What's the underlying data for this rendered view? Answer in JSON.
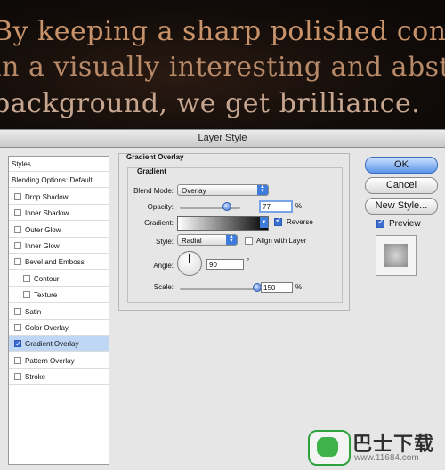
{
  "hero": {
    "line1": "By keeping a sharp polished content",
    "line2": "in a visually interesting and abstract",
    "line3": "background, we get brilliance."
  },
  "dialog": {
    "title": "Layer Style",
    "styles_panel": {
      "items": [
        {
          "label": "Styles",
          "checkbox": false,
          "checked": false,
          "selected": false,
          "indent": 0
        },
        {
          "label": "Blending Options: Default",
          "checkbox": false,
          "checked": false,
          "selected": false,
          "indent": 0
        },
        {
          "label": "Drop Shadow",
          "checkbox": true,
          "checked": false,
          "selected": false,
          "indent": 0
        },
        {
          "label": "Inner Shadow",
          "checkbox": true,
          "checked": false,
          "selected": false,
          "indent": 0
        },
        {
          "label": "Outer Glow",
          "checkbox": true,
          "checked": false,
          "selected": false,
          "indent": 0
        },
        {
          "label": "Inner Glow",
          "checkbox": true,
          "checked": false,
          "selected": false,
          "indent": 0
        },
        {
          "label": "Bevel and Emboss",
          "checkbox": true,
          "checked": false,
          "selected": false,
          "indent": 0
        },
        {
          "label": "Contour",
          "checkbox": true,
          "checked": false,
          "selected": false,
          "indent": 1
        },
        {
          "label": "Texture",
          "checkbox": true,
          "checked": false,
          "selected": false,
          "indent": 1
        },
        {
          "label": "Satin",
          "checkbox": true,
          "checked": false,
          "selected": false,
          "indent": 0
        },
        {
          "label": "Color Overlay",
          "checkbox": true,
          "checked": false,
          "selected": false,
          "indent": 0
        },
        {
          "label": "Gradient Overlay",
          "checkbox": true,
          "checked": true,
          "selected": true,
          "indent": 0
        },
        {
          "label": "Pattern Overlay",
          "checkbox": true,
          "checked": false,
          "selected": false,
          "indent": 0
        },
        {
          "label": "Stroke",
          "checkbox": true,
          "checked": false,
          "selected": false,
          "indent": 0
        }
      ]
    },
    "gradient_overlay": {
      "group_title": "Gradient Overlay",
      "subgroup_title": "Gradient",
      "blend_mode_label": "Blend Mode:",
      "blend_mode_value": "Overlay",
      "opacity_label": "Opacity:",
      "opacity_value": "77",
      "opacity_level": 0.77,
      "opacity_unit": "%",
      "gradient_label": "Gradient:",
      "reverse_label": "Reverse",
      "reverse_checked": true,
      "style_label": "Style:",
      "style_value": "Radial",
      "align_label": "Align with Layer",
      "align_checked": false,
      "angle_label": "Angle:",
      "angle_value": "90",
      "angle_unit": "°",
      "scale_label": "Scale:",
      "scale_value": "150",
      "scale_level": 1.0,
      "scale_unit": "%"
    },
    "buttons": {
      "ok": "OK",
      "cancel": "Cancel",
      "new_style": "New Style...",
      "preview_label": "Preview",
      "preview_checked": true
    }
  },
  "watermark": {
    "brand": "巴士下载",
    "url": "www.11684.com"
  }
}
